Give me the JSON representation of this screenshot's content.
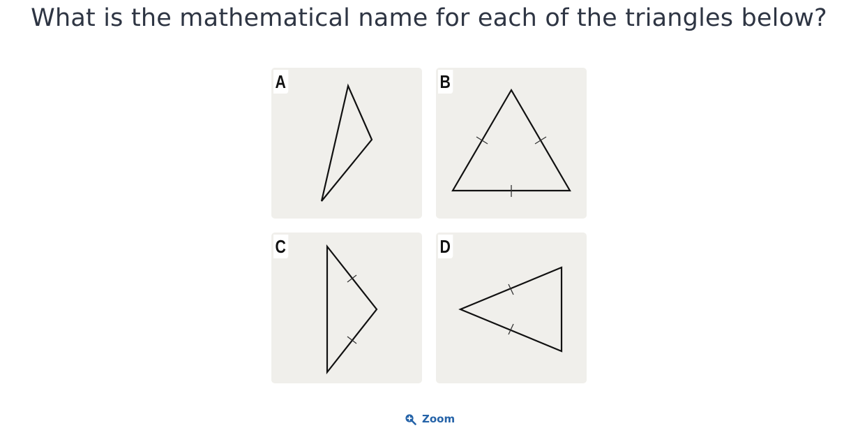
{
  "question": {
    "text": "What is the mathematical name for each of the triangles below?"
  },
  "panels": [
    {
      "label": "A"
    },
    {
      "label": "B"
    },
    {
      "label": "C"
    },
    {
      "label": "D"
    }
  ],
  "zoom": {
    "label": "Zoom",
    "icon": "zoom-in-icon"
  },
  "colors": {
    "text": "#2e3543",
    "panel_background": "#f0efeb",
    "link": "#2563a8"
  }
}
